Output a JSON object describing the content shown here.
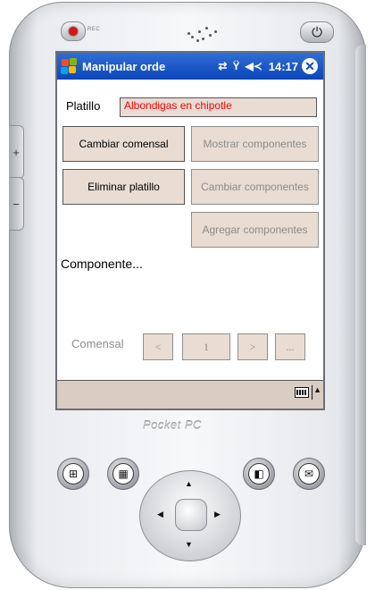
{
  "device": {
    "rec_label": "REC",
    "brand_text": "Pocket PC",
    "power_icon": "power-icon"
  },
  "titlebar": {
    "title": "Manipular orde",
    "time": "14:17",
    "icons": [
      "sync-icon",
      "signal-icon",
      "volume-icon",
      "close-icon"
    ]
  },
  "form": {
    "platillo_label": "Platillo",
    "platillo_value": "Albondigas en chipotle",
    "buttons": {
      "cambiar_comensal": "Cambiar comensal",
      "mostrar_componentes": "Mostrar componentes",
      "eliminar_platillo": "Eliminar platillo",
      "cambiar_componentes": "Cambiar componentes",
      "agregar_componentes": "Agregar componentes"
    },
    "componente_label": "Componente...",
    "comensal_label": "Comensal",
    "nav": {
      "prev": "<",
      "page": "1",
      "next": ">",
      "more": "..."
    }
  },
  "colors": {
    "titlebar": "#0b46b8",
    "field_bg": "#e8dcd3",
    "value_text": "#ff0000"
  }
}
